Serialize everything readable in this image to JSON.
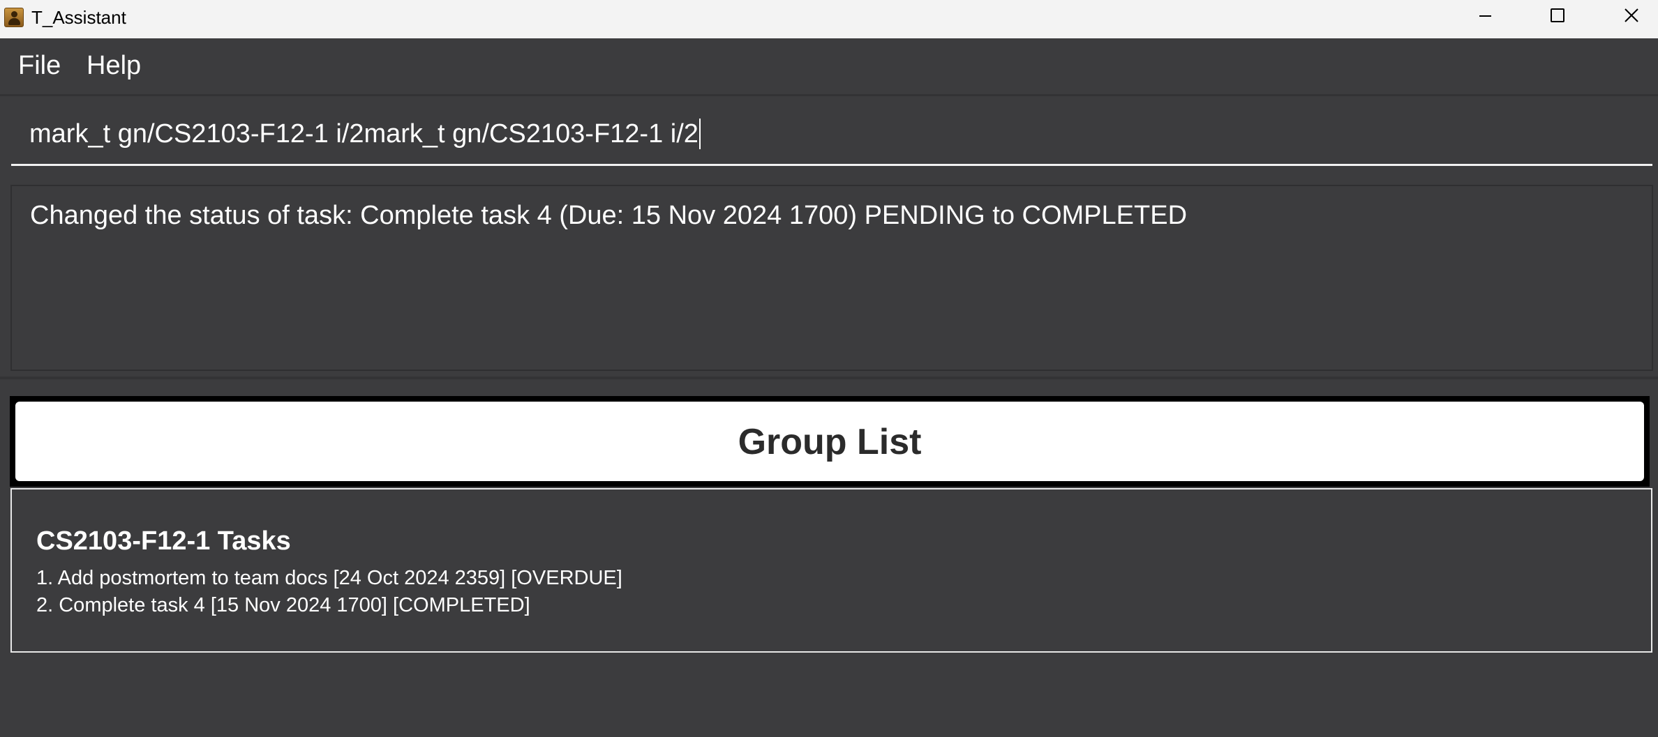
{
  "window": {
    "title": "T_Assistant",
    "icons": {
      "app": "app-icon",
      "minimize": "minimize-icon",
      "maximize": "maximize-icon",
      "close": "close-icon"
    }
  },
  "menu": {
    "items": [
      {
        "label": "File"
      },
      {
        "label": "Help"
      }
    ]
  },
  "command": {
    "value": "mark_t gn/CS2103-F12-1 i/2mark_t gn/CS2103-F12-1 i/2"
  },
  "result": {
    "message": "Changed the status of task: Complete task 4 (Due: 15 Nov 2024 1700) PENDING to COMPLETED"
  },
  "group_list": {
    "header": "Group List",
    "groups": [
      {
        "name": "CS2103-F12-1 Tasks",
        "tasks": [
          "1. Add postmortem to team docs [24 Oct 2024 2359] [OVERDUE]",
          "2. Complete task 4 [15 Nov 2024 1700] [COMPLETED]"
        ]
      }
    ]
  },
  "colors": {
    "background": "#3c3c3e",
    "titlebar": "#f3f3f3",
    "text": "#ffffff",
    "header_text": "#2b2b2b"
  }
}
